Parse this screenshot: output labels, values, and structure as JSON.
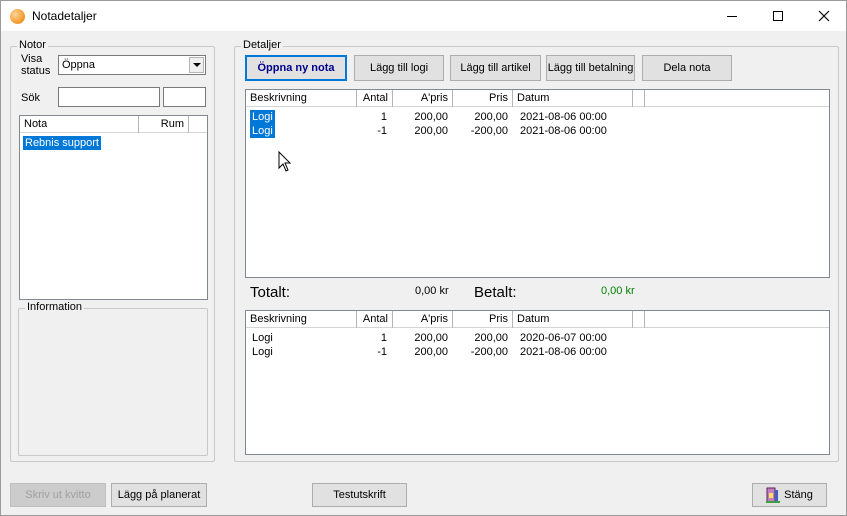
{
  "window": {
    "title": "Notadetaljer"
  },
  "notor": {
    "legend": "Notor",
    "visa_status_label": "Visa\nstatus",
    "status_value": "Öppna",
    "sok_label": "Sök",
    "sok_value": "",
    "sok_value2": "",
    "columns": [
      "Nota",
      "Rum"
    ],
    "rows": [
      {
        "nota": "Rebnis support",
        "rum": "",
        "selected": true
      }
    ]
  },
  "information": {
    "legend": "Information"
  },
  "detaljer": {
    "legend": "Detaljer",
    "buttons": {
      "open_new": "Öppna ny nota",
      "add_logi": "Lägg till logi",
      "add_artikel": "Lägg till artikel",
      "add_betalning": "Lägg till betalning",
      "dela": "Dela nota"
    },
    "columns": [
      "Beskrivning",
      "Antal",
      "A'pris",
      "Pris",
      "Datum"
    ],
    "rows_top": [
      {
        "beskrivning": "Logi",
        "antal": "1",
        "apris": "200,00",
        "pris": "200,00",
        "datum": "2021-08-06 00:00",
        "selected": true
      },
      {
        "beskrivning": "Logi",
        "antal": "-1",
        "apris": "200,00",
        "pris": "-200,00",
        "datum": "2021-08-06 00:00",
        "selected": true
      }
    ],
    "totalt_label": "Totalt:",
    "totalt_value": "0,00 kr",
    "betalt_label": "Betalt:",
    "betalt_value": "0,00 kr",
    "betalt_color": "#008000",
    "rows_bottom": [
      {
        "beskrivning": "Logi",
        "antal": "1",
        "apris": "200,00",
        "pris": "200,00",
        "datum": "2020-06-07 00:00"
      },
      {
        "beskrivning": "Logi",
        "antal": "-1",
        "apris": "200,00",
        "pris": "-200,00",
        "datum": "2021-08-06 00:00"
      }
    ]
  },
  "footer": {
    "skriv_ut": "Skriv ut kvitto",
    "lagg_pa": "Lägg på planerat",
    "testutskrift": "Testutskrift",
    "stang": "Stäng"
  },
  "colors": {
    "selection": "#0078d7",
    "accent_button_text": "#00008b"
  }
}
